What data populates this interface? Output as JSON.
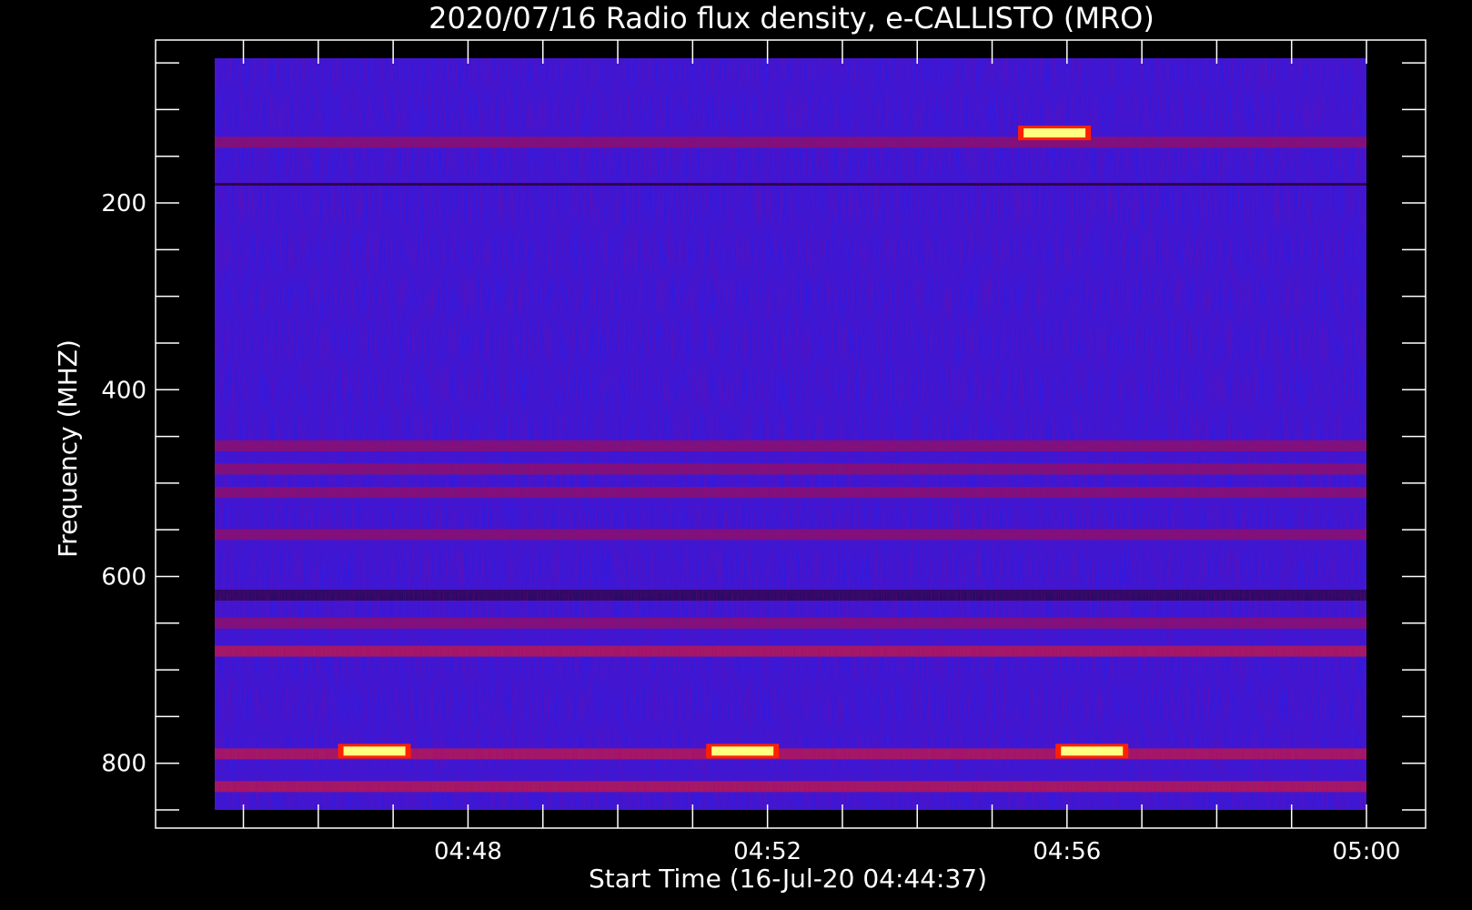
{
  "chart_data": {
    "type": "heatmap",
    "title": "2020/07/16  Radio flux density, e-CALLISTO (MRO)",
    "xlabel": "Start Time (16-Jul-20 04:44:37)",
    "ylabel": "Frequency (MHZ)",
    "x_range": [
      "04:44:37",
      "05:00:00"
    ],
    "y_range": [
      45,
      850
    ],
    "y_inverted": true,
    "x_ticks": [
      "04:48",
      "04:52",
      "04:56",
      "05:00"
    ],
    "y_ticks": [
      200,
      400,
      600,
      800
    ],
    "grid": false,
    "colormap": [
      "#000000",
      "#0000ff",
      "#b01030",
      "#ff2000",
      "#ffff80"
    ],
    "features": {
      "horizontal_bands_mhz": [
        {
          "freq": 135,
          "intensity": "medium"
        },
        {
          "freq": 180,
          "intensity": "dark-dotted"
        },
        {
          "freq": 460,
          "intensity": "medium"
        },
        {
          "freq": 485,
          "intensity": "medium"
        },
        {
          "freq": 510,
          "intensity": "medium"
        },
        {
          "freq": 555,
          "intensity": "medium"
        },
        {
          "freq": 620,
          "intensity": "dark"
        },
        {
          "freq": 650,
          "intensity": "medium"
        },
        {
          "freq": 680,
          "intensity": "strong"
        },
        {
          "freq": 790,
          "intensity": "strong"
        },
        {
          "freq": 825,
          "intensity": "strong"
        }
      ],
      "bright_bursts": [
        {
          "time": "04:46:45",
          "freq": 787
        },
        {
          "time": "04:51:40",
          "freq": 787
        },
        {
          "time": "04:56:20",
          "freq": 787
        },
        {
          "time": "04:55:50",
          "freq": 125
        }
      ]
    }
  }
}
